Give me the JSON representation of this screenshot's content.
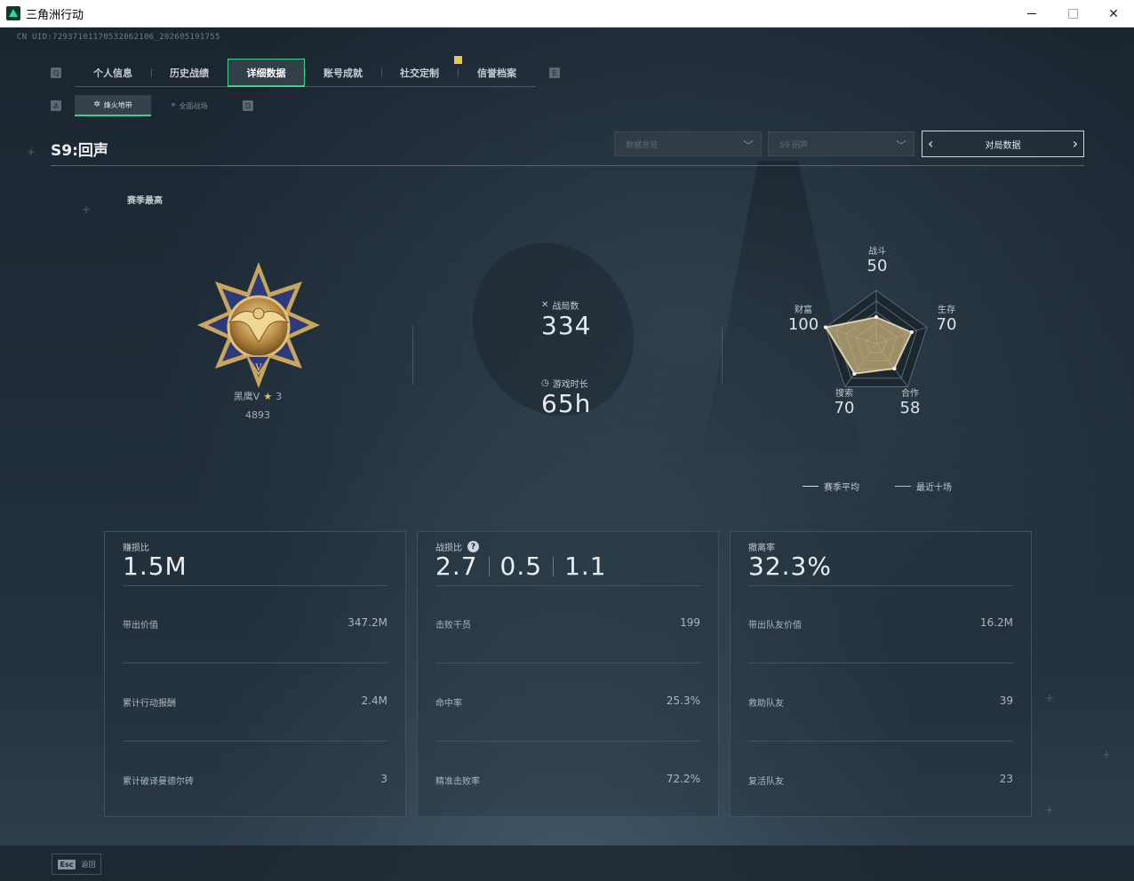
{
  "window": {
    "title": "三角洲行动"
  },
  "uid": "CN UID:7293710117053206210​6_202605191755",
  "tabs": [
    {
      "label": "个人信息",
      "key": "q"
    },
    {
      "label": "历史战绩"
    },
    {
      "label": "详细数据",
      "active": true
    },
    {
      "label": "账号成就"
    },
    {
      "label": "社交定制"
    },
    {
      "label": "信誉档案",
      "badge": true
    }
  ],
  "tab_keys": {
    "left": "Q",
    "right": "E"
  },
  "subtabs": [
    {
      "label": "烽火地带",
      "active": true
    },
    {
      "label": "全面战场"
    }
  ],
  "subtab_keys": {
    "left": "A",
    "right": "D"
  },
  "season": {
    "title": "S9:回声"
  },
  "filters": {
    "data_type": "数据总览",
    "season": "S9 回声",
    "nav_label": "对局数据"
  },
  "rank": {
    "section_label": "赛季最高",
    "name": "黑鹰V",
    "stars": "3",
    "score": "4893"
  },
  "overview": {
    "matches_label": "战局数",
    "matches_value": "334",
    "playtime_label": "游戏时长",
    "playtime_value": "65h"
  },
  "radar": {
    "axes": [
      {
        "name": "战斗",
        "value": 50
      },
      {
        "name": "生存",
        "value": 70
      },
      {
        "name": "合作",
        "value": 58
      },
      {
        "name": "搜索",
        "value": 70
      },
      {
        "name": "财富",
        "value": 100
      }
    ],
    "legend": [
      {
        "label": "赛季平均",
        "color": "#d8dde1"
      },
      {
        "label": "最近十场",
        "color": "#d9c27a"
      }
    ],
    "fill_color": "#c9b37a"
  },
  "cards": [
    {
      "title": "赚损比",
      "big": "1.5M",
      "rows": [
        {
          "label": "带出价值",
          "value": "347.2M"
        },
        {
          "label": "累计行动报酬",
          "value": "2.4M"
        },
        {
          "label": "累计破译曼德尔砖",
          "value": "3"
        }
      ]
    },
    {
      "title": "战损比",
      "big_values": [
        "2.7",
        "0.5",
        "1.1"
      ],
      "help": "?",
      "rows": [
        {
          "label": "击败干员",
          "value": "199"
        },
        {
          "label": "命中率",
          "value": "25.3%"
        },
        {
          "label": "精准击败率",
          "value": "72.2%"
        }
      ]
    },
    {
      "title": "撤离率",
      "big": "32.3%",
      "rows": [
        {
          "label": "带出队友价值",
          "value": "16.2M"
        },
        {
          "label": "救助队友",
          "value": "39"
        },
        {
          "label": "复活队友",
          "value": "23"
        }
      ]
    }
  ],
  "footer": {
    "esc_key": "Esc",
    "esc_label": "返回"
  }
}
